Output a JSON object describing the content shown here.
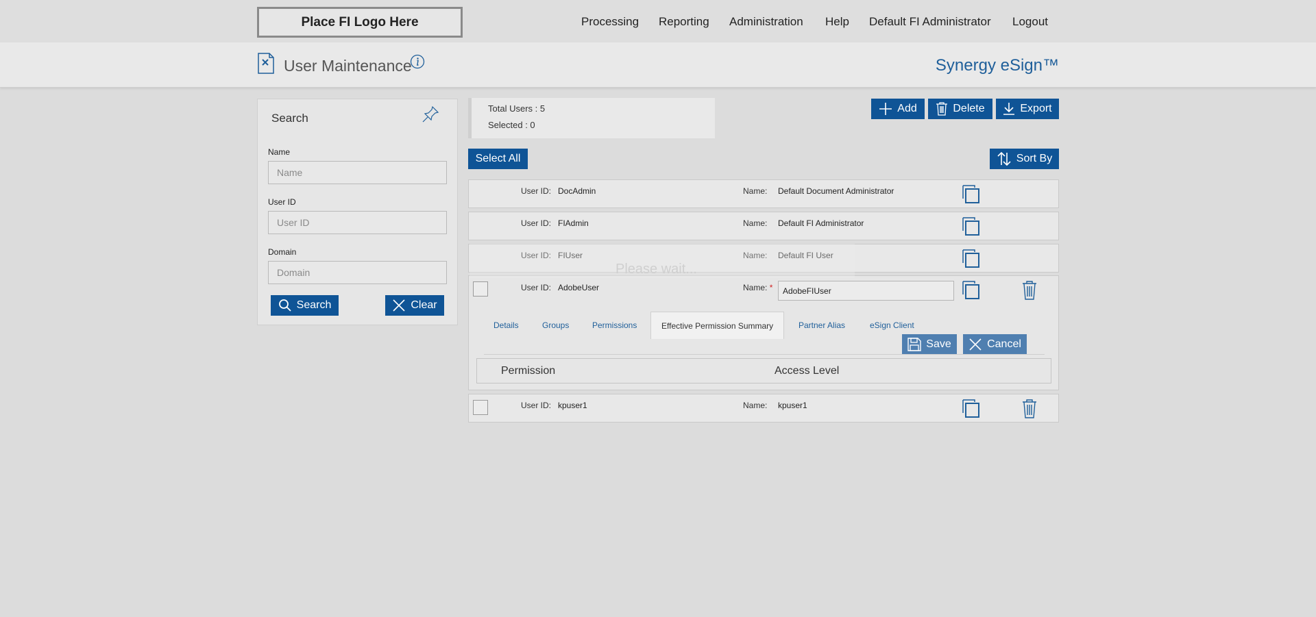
{
  "header": {
    "logo_text": "Place FI Logo Here",
    "nav": [
      "Processing",
      "Reporting",
      "Administration",
      "Help",
      "Default FI Administrator",
      "Logout"
    ],
    "page_title": "User Maintenance",
    "brand": "Synergy eSign™"
  },
  "search": {
    "title": "Search",
    "fields": [
      {
        "label": "Name",
        "placeholder": "Name"
      },
      {
        "label": "User ID",
        "placeholder": "User ID"
      },
      {
        "label": "Domain",
        "placeholder": "Domain"
      }
    ],
    "search_label": "Search",
    "clear_label": "Clear"
  },
  "summary": {
    "total_users": "Total Users : 5",
    "selected": "Selected : 0"
  },
  "toolbar": {
    "add_label": "Add",
    "delete_label": "Delete",
    "export_label": "Export",
    "select_all_label": "Select All",
    "sort_label": "Sort By"
  },
  "list": {
    "uid_label": "User ID:",
    "name_label": "Name:",
    "rows": [
      {
        "user_id": "DocAdmin",
        "name": "Default Document Administrator"
      },
      {
        "user_id": "FIAdmin",
        "name": "Default FI Administrator"
      },
      {
        "user_id": "FIUser",
        "name": "Default FI User"
      },
      {
        "user_id": "AdobeUser",
        "name": "AdobeFIUser"
      },
      {
        "user_id": "kpuser1",
        "name": "kpuser1"
      }
    ]
  },
  "status": {
    "loading_text": "Please wait..."
  },
  "detail": {
    "required_mark": "*",
    "tabs": [
      "Details",
      "Groups",
      "Permissions",
      "Effective Permission Summary",
      "Partner Alias",
      "eSign Client"
    ],
    "active_tab": "Effective Permission Summary",
    "save_label": "Save",
    "cancel_label": "Cancel",
    "table_headers": [
      "Permission",
      "Access Level"
    ]
  },
  "colors": {
    "accent": "#0f5496",
    "brand": "#1f5f9a",
    "background": "#dcdcdc"
  }
}
